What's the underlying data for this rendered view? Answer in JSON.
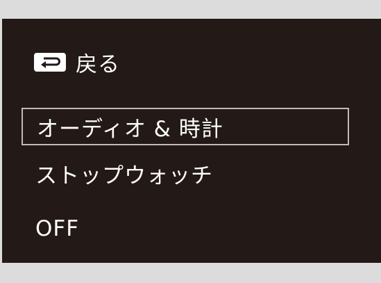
{
  "menu": {
    "back_label": "戻る",
    "back_icon": "return-arrow-icon",
    "items": [
      {
        "label": "オーディオ & 時計"
      },
      {
        "label": "ストップウォッチ"
      },
      {
        "label": "OFF"
      }
    ],
    "selected_index": 0
  },
  "colors": {
    "background": "#dcdcdc",
    "screen": "#231916",
    "text": "#ffffff",
    "selection_border": "#bdbdbd"
  }
}
